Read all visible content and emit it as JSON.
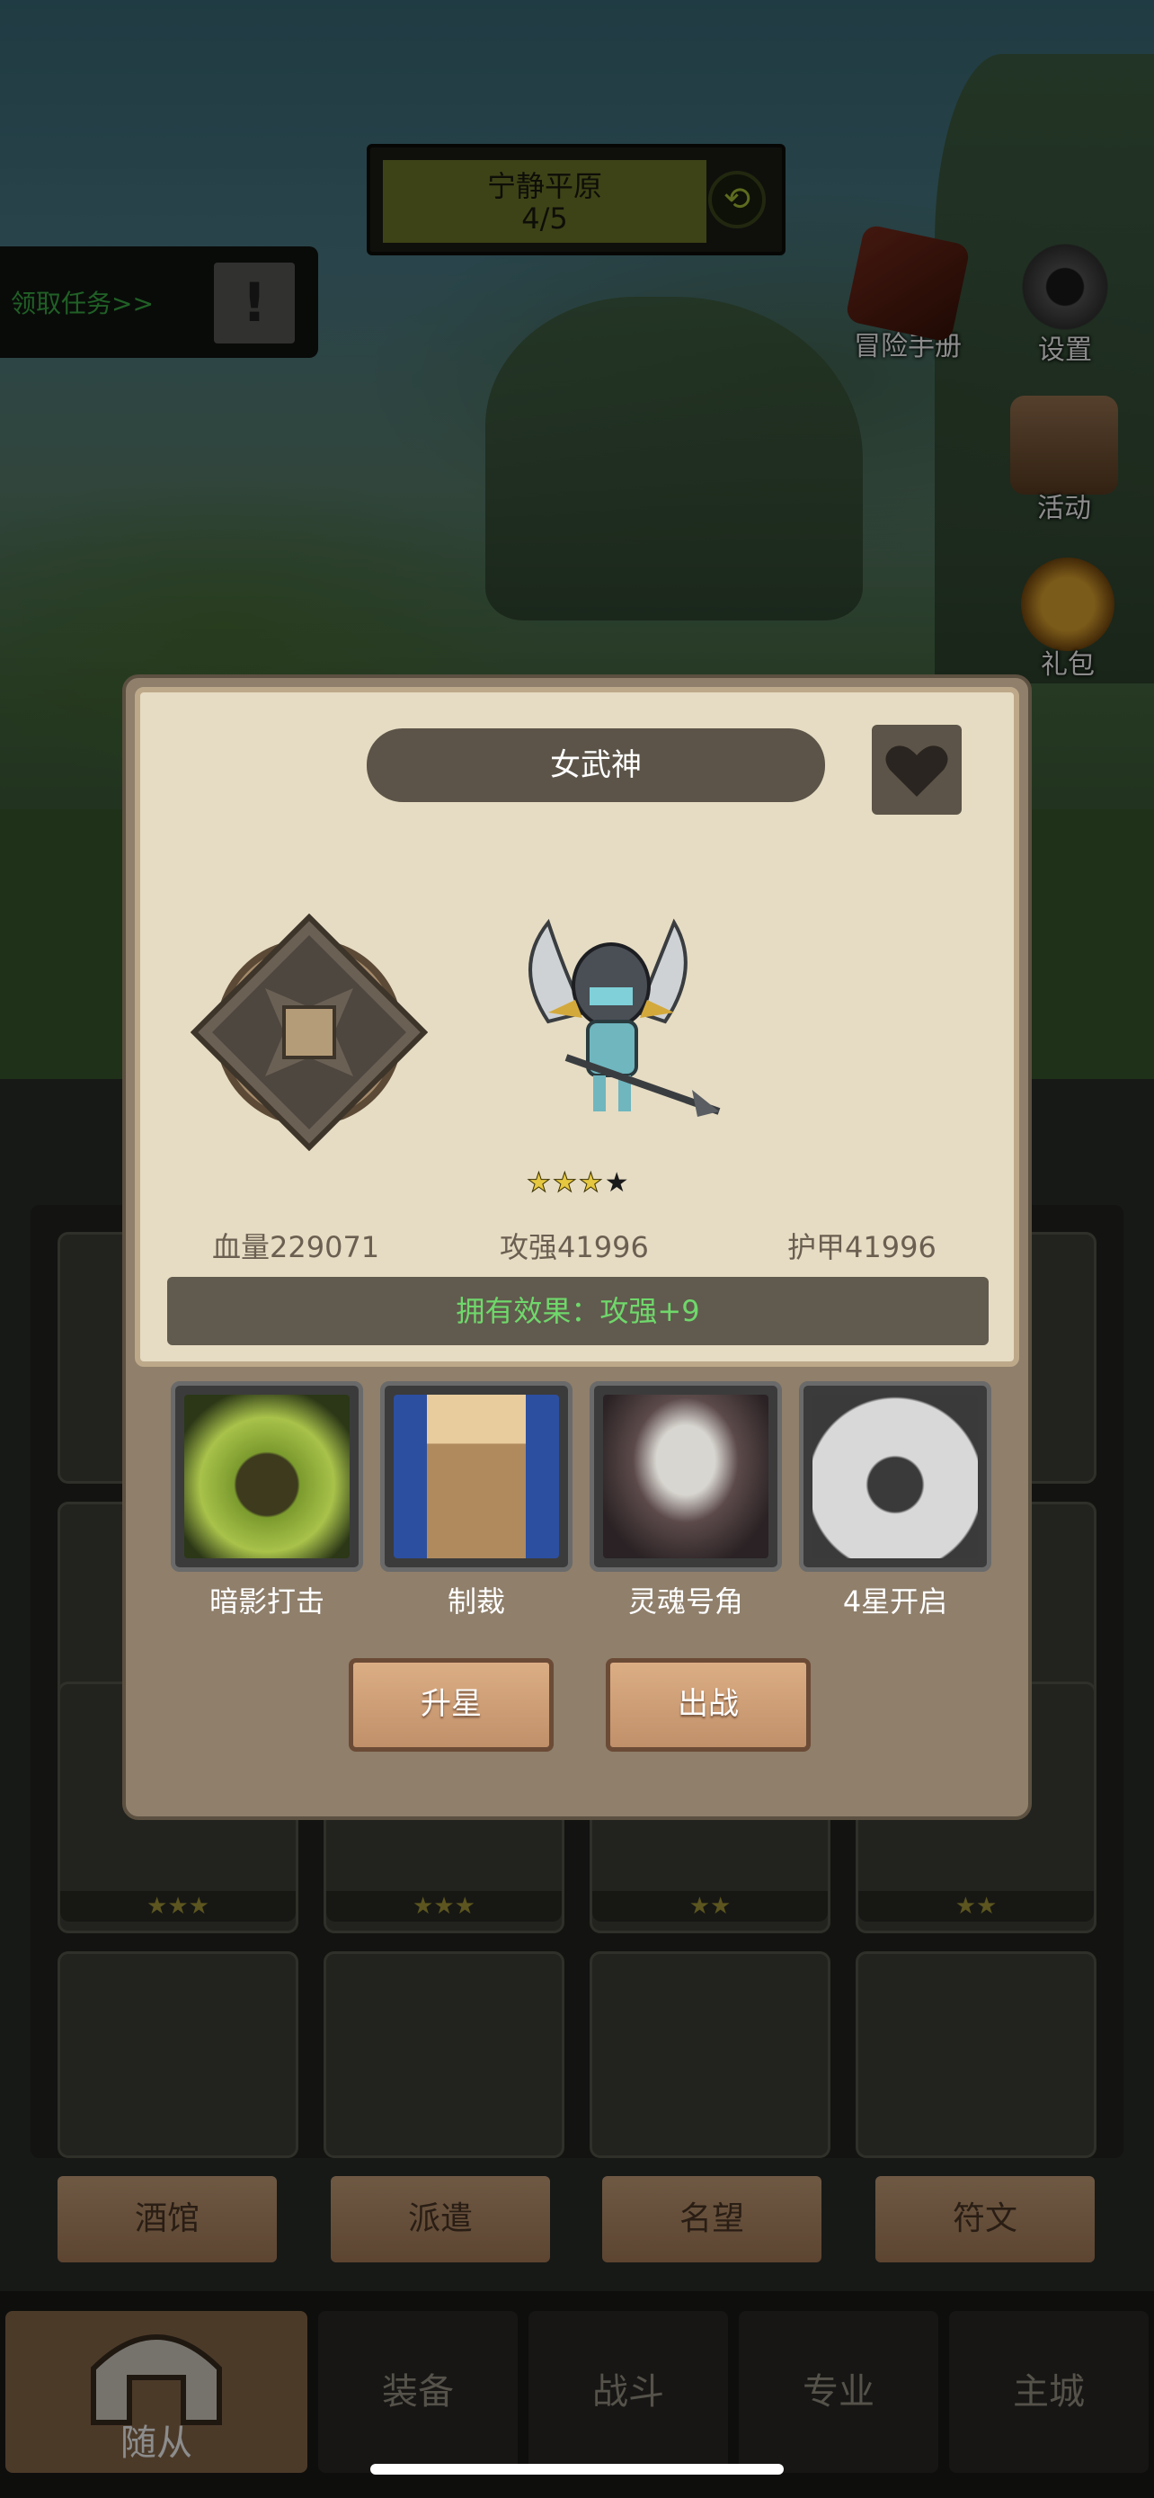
{
  "top": {
    "stage_name": "宁静平原",
    "stage_progress": "4/5",
    "quest_label": "领取任务>>",
    "side_buttons": [
      {
        "label": "冒险手册",
        "icon": "book-icon"
      },
      {
        "label": "设置",
        "icon": "gear-icon"
      },
      {
        "label": "活动",
        "icon": "scroll-icon"
      },
      {
        "label": "礼包",
        "icon": "gift-icon"
      }
    ]
  },
  "hero": {
    "name": "女武神",
    "stars": {
      "filled": 3,
      "total": 4
    },
    "stats": {
      "hp": "血量229071",
      "attack": "攻强41996",
      "armor": "护甲41996"
    },
    "effect": "拥有效果：攻强+9",
    "skills": [
      {
        "name": "暗影打击",
        "icon": "shadow-strike-icon"
      },
      {
        "name": "制裁",
        "icon": "hammer-icon"
      },
      {
        "name": "灵魂号角",
        "icon": "skull-horn-icon"
      },
      {
        "name": "4星开启",
        "icon": "locked-fist-icon"
      }
    ],
    "buttons": {
      "upgrade": "升星",
      "deploy": "出战"
    }
  },
  "tabs": [
    "酒馆",
    "派遣",
    "名望",
    "符文"
  ],
  "nav": [
    "随从",
    "装备",
    "战斗",
    "专业",
    "主城"
  ],
  "list_stars": [
    "★★★",
    "★★★",
    "★★",
    "★★"
  ]
}
